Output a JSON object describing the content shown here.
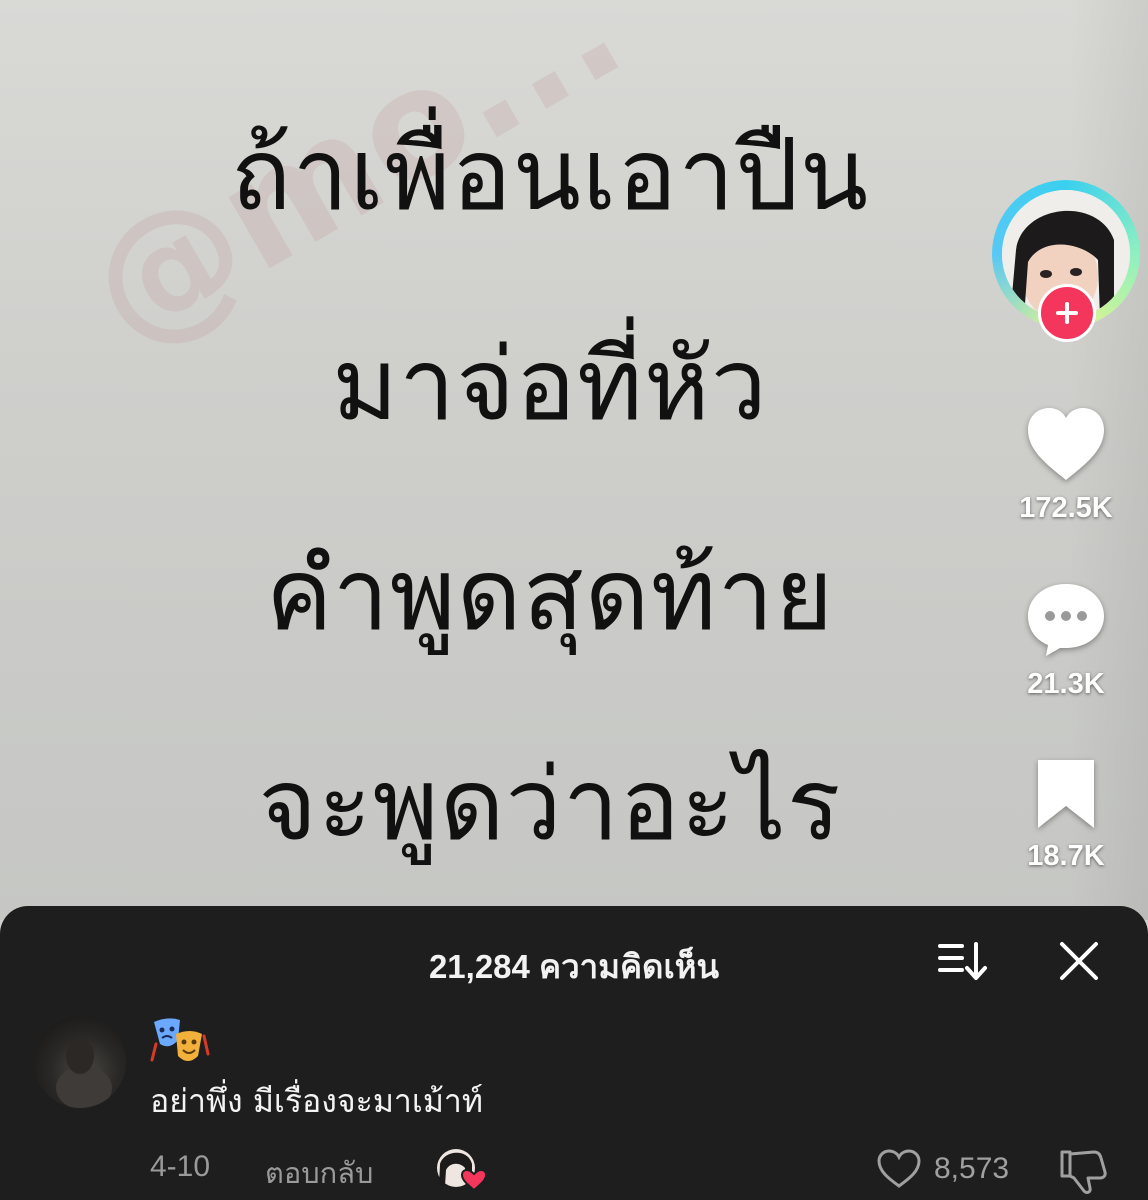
{
  "video": {
    "quote_lines": [
      "ถ้าเพื่อนเอาปืน",
      "มาจ่อที่หัว",
      "คำพูดสุดท้าย",
      "จะพูดว่าอะไร"
    ],
    "watermark": "@mo..."
  },
  "rail": {
    "avatar_icon": "creator-avatar",
    "follow_icon": "plus-icon",
    "like_count": "172.5K",
    "comment_count": "21.3K",
    "bookmark_count": "18.7K"
  },
  "comments": {
    "title": "21,284 ความคิดเห็น",
    "sort_icon": "sort-icon",
    "close_icon": "close-icon",
    "items": [
      {
        "name_emoji": "🎭",
        "text": "อย่าพึ่ง มีเรื่องจะมาเม้าท์",
        "date": "4-10",
        "reply_label": "ตอบกลับ",
        "like_count": "8,573"
      }
    ]
  },
  "colors": {
    "panel_bg": "#1e1e1e",
    "follow_red": "#f5365c",
    "muted_text": "#9a9a9a"
  }
}
